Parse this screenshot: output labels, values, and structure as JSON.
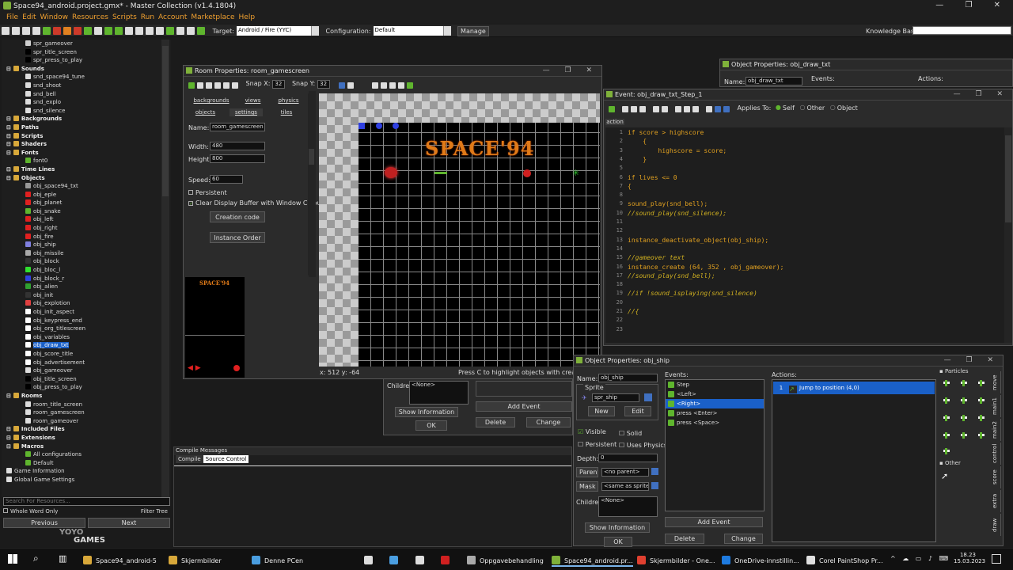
{
  "window": {
    "title": "Space94_android.project.gmx* - Master Collection (v1.4.1804)",
    "controls": "— ❐ ✕"
  },
  "menu": [
    "File",
    "Edit",
    "Window",
    "Resources",
    "Scripts",
    "Run",
    "Account",
    "Marketplace",
    "Help"
  ],
  "toolbar": {
    "target_label": "Target:",
    "target_value": "Android / Fire (YYC)",
    "config_label": "Configuration:",
    "config_value": "Default",
    "manage": "Manage",
    "kb_label": "Knowledge Base"
  },
  "tree": [
    {
      "t": "spr_gameover",
      "d": 3,
      "c": "#d0d0d0"
    },
    {
      "t": "spr_title_screen",
      "d": 3,
      "c": "#000"
    },
    {
      "t": "spr_press_to_play",
      "d": 3,
      "c": "#000"
    },
    {
      "t": "Sounds",
      "f": 1,
      "d": 1
    },
    {
      "t": "snd_space94_tune",
      "d": 3,
      "c": "#ddd"
    },
    {
      "t": "snd_shoot",
      "d": 3,
      "c": "#ddd"
    },
    {
      "t": "snd_bell",
      "d": 3,
      "c": "#ddd"
    },
    {
      "t": "snd_explo",
      "d": 3,
      "c": "#ddd"
    },
    {
      "t": "snd_silence",
      "d": 3,
      "c": "#ddd"
    },
    {
      "t": "Backgrounds",
      "f": 1,
      "d": 1
    },
    {
      "t": "Paths",
      "f": 1,
      "d": 1
    },
    {
      "t": "Scripts",
      "f": 1,
      "d": 1
    },
    {
      "t": "Shaders",
      "f": 1,
      "d": 1
    },
    {
      "t": "Fonts",
      "f": 1,
      "d": 1
    },
    {
      "t": "font0",
      "d": 3,
      "c": "#5fb52e"
    },
    {
      "t": "Time Lines",
      "f": 1,
      "d": 1
    },
    {
      "t": "Objects",
      "f": 1,
      "d": 1
    },
    {
      "t": "obj_space94_txt",
      "d": 3,
      "c": "#999"
    },
    {
      "t": "obj_eple",
      "d": 3,
      "c": "#e02020"
    },
    {
      "t": "obj_planet",
      "d": 3,
      "c": "#e02020"
    },
    {
      "t": "obj_snake",
      "d": 3,
      "c": "#5fb52e"
    },
    {
      "t": "obj_left",
      "d": 3,
      "c": "#e02020"
    },
    {
      "t": "obj_right",
      "d": 3,
      "c": "#e02020"
    },
    {
      "t": "obj_fire",
      "d": 3,
      "c": "#e02020"
    },
    {
      "t": "obj_ship",
      "d": 3,
      "c": "#8080e0"
    },
    {
      "t": "obj_missile",
      "d": 3,
      "c": "#aaa"
    },
    {
      "t": "obj_block",
      "d": 3,
      "c": "#333"
    },
    {
      "t": "obj_bloc_l",
      "d": 3,
      "c": "#30e030"
    },
    {
      "t": "obj_block_r",
      "d": 3,
      "c": "#3040e0"
    },
    {
      "t": "obj_alien",
      "d": 3,
      "c": "#30a030"
    },
    {
      "t": "obj_init",
      "d": 3,
      "c": "#333"
    },
    {
      "t": "obj_explotion",
      "d": 3,
      "c": "#e04040"
    },
    {
      "t": "obj_init_aspect",
      "d": 3,
      "c": "#fff"
    },
    {
      "t": "obj_keypress_end",
      "d": 3,
      "c": "#fff"
    },
    {
      "t": "obj_org_titlescreen",
      "d": 3,
      "c": "#fff"
    },
    {
      "t": "obj_variables",
      "d": 3,
      "c": "#fff"
    },
    {
      "t": "obj_draw_txt",
      "d": 3,
      "c": "#fff",
      "sel": 1
    },
    {
      "t": "obj_score_title",
      "d": 3,
      "c": "#fff"
    },
    {
      "t": "obj_advertisement",
      "d": 3,
      "c": "#fff"
    },
    {
      "t": "obj_gameover",
      "d": 3,
      "c": "#ddd"
    },
    {
      "t": "obj_title_screen",
      "d": 3,
      "c": "#000"
    },
    {
      "t": "obj_press_to_play",
      "d": 3,
      "c": "#000"
    },
    {
      "t": "Rooms",
      "f": 1,
      "d": 1
    },
    {
      "t": "room_title_screen",
      "d": 3,
      "c": "#ddd"
    },
    {
      "t": "room_gamescreen",
      "d": 3,
      "c": "#ddd"
    },
    {
      "t": "room_gameover",
      "d": 3,
      "c": "#ddd"
    },
    {
      "t": "Included Files",
      "f": 1,
      "d": 1
    },
    {
      "t": "Extensions",
      "f": 1,
      "d": 1
    },
    {
      "t": "Macros",
      "f": 1,
      "d": 1
    },
    {
      "t": "All configurations",
      "d": 3,
      "c": "#5fb52e"
    },
    {
      "t": "Default",
      "d": 3,
      "c": "#5fb52e"
    },
    {
      "t": "Game Information",
      "d": 1,
      "c": "#ddd"
    },
    {
      "t": "Global Game Settings",
      "d": 1,
      "c": "#ddd"
    }
  ],
  "search": {
    "placeholder": "Search For Resources...",
    "whole_word": "Whole Word Only",
    "filter": "Filter Tree",
    "previous": "Previous",
    "next": "Next"
  },
  "logo": {
    "line1": "YOYO",
    "line2": "GAMES"
  },
  "room": {
    "title": "Room Properties: room_gamescreen",
    "snapx_label": "Snap X:",
    "snapx": "32",
    "snapy_label": "Snap Y:",
    "snapy": "32",
    "tabs1": [
      "backgrounds",
      "views",
      "physics"
    ],
    "tabs2": [
      "objects",
      "settings",
      "tiles"
    ],
    "name_label": "Name:",
    "name": "room_gamescreen",
    "width_label": "Width:",
    "width": "480",
    "height_label": "Height:",
    "height": "800",
    "speed_label": "Speed:",
    "speed": "60",
    "persistent": "Persistent",
    "clear": "Clear Display Buffer with Window Colour",
    "creation": "Creation code",
    "instance": "Instance Order",
    "coords": "x: 512     y: -64",
    "hint": "Press C to highlight objects with creation",
    "game_title": "SPACE'94",
    "thumb_title": "SPACE'94"
  },
  "objtxt": {
    "title": "Object Properties: obj_draw_txt",
    "name_label": "Name:",
    "name": "obj_draw_txt",
    "events": "Events:",
    "actions": "Actions:"
  },
  "code": {
    "title": "Event: obj_draw_txt_Step_1",
    "applies": "Applies To:",
    "self": "Self",
    "other": "Other",
    "object": "Object",
    "tab": "action",
    "lines": [
      "if score > highscore",
      "    {",
      "        highscore = score;",
      "    }",
      "",
      "if lives <= 0",
      "{",
      "",
      "sound_play(snd_bell);",
      "//sound_play(snd_silence);",
      "",
      "",
      "instance_deactivate_object(obj_ship);",
      "",
      "//gameover text",
      "instance_create (64, 352 , obj_gameover);",
      "//sound_play(snd_bell);",
      "",
      "//if !sound_isplaying(snd_silence)",
      "",
      "//{",
      "",
      ""
    ]
  },
  "behind": {
    "children_label": "Children:",
    "children": "<None>",
    "show_info": "Show Information",
    "ok": "OK",
    "add_event": "Add Event",
    "delete": "Delete",
    "change": "Change"
  },
  "ship": {
    "title": "Object Properties: obj_ship",
    "name_label": "Name:",
    "name": "obj_ship",
    "sprite_label": "Sprite",
    "sprite": "spr_ship",
    "new": "New",
    "edit": "Edit",
    "visible": "Visible",
    "solid": "Solid",
    "persistent": "Persistent",
    "physics": "Uses Physics",
    "depth_label": "Depth:",
    "depth": "0",
    "parent": "Parent",
    "parent_val": "<no parent>",
    "mask": "Mask",
    "mask_val": "<same as sprite>",
    "children_label": "Children:",
    "children": "<None>",
    "show_info": "Show Information",
    "ok": "OK",
    "events_label": "Events:",
    "events": [
      "Step",
      "<Left>",
      "<Right>",
      "press <Enter>",
      "press <Space>"
    ],
    "add_event": "Add Event",
    "delete": "Delete",
    "change": "Change",
    "actions_label": "Actions:",
    "action_num": "1",
    "action": "Jump to position (4,0)",
    "particles": "Particles",
    "other": "Other",
    "vtabs": [
      "move",
      "main1",
      "main2",
      "control",
      "score",
      "extra",
      "draw"
    ]
  },
  "compile": {
    "title": "Compile Messages",
    "tab1": "Compile",
    "tab2": "Source Control"
  },
  "taskbar": {
    "items": [
      "Space94_android-5",
      "Skjermbilder",
      "Denne PCen",
      "",
      "",
      "",
      "",
      "",
      "",
      "Oppgavebehandling",
      "Space94_android.pr...",
      "Skjermbilder - One...",
      "OneDrive-innstillin...",
      "Corel PaintShop Pr..."
    ],
    "time": "18.23",
    "date": "15.03.2023"
  },
  "colors": {
    "accent": "#1a60c8",
    "code_text": "#e0a020",
    "menu": "#f0a030"
  }
}
